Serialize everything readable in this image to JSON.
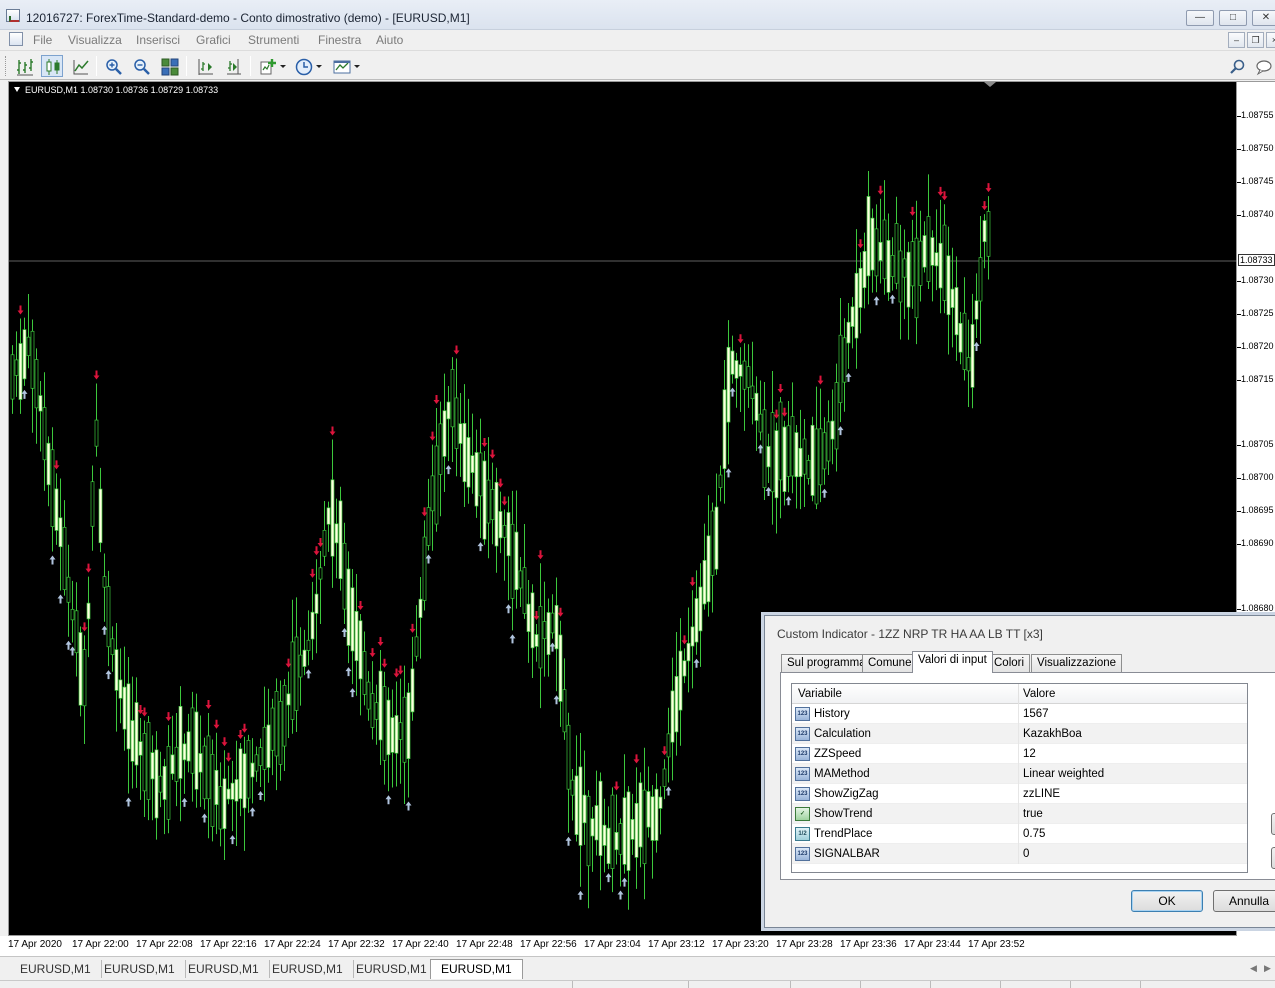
{
  "window": {
    "title": "12016727: ForexTime-Standard-demo - Conto dimostrativo (demo) - [EURUSD,M1]"
  },
  "menu": {
    "items": [
      "File",
      "Visualizza",
      "Inserisci",
      "Grafici",
      "Strumenti",
      "Finestra",
      "Aiuto"
    ]
  },
  "toolbar": {
    "buttons": [
      "bar-chart-icon",
      "candlestick-icon",
      "line-chart-icon",
      "zoom-in-icon",
      "zoom-out-icon",
      "tile-windows-icon",
      "chart-shift-icon",
      "autoscroll-icon",
      "indicators-icon",
      "periods-icon",
      "templates-icon"
    ],
    "right_icons": [
      "search-icon",
      "chat-icon"
    ]
  },
  "chart": {
    "symbol_label": "EURUSD,M1  1.08730 1.08736 1.08729 1.08733",
    "current_price": "1.08733",
    "price_labels": [
      "1.08755",
      "1.08750",
      "1.08745",
      "1.08740",
      "1.08730",
      "1.08725",
      "1.08720",
      "1.08715",
      "1.08705",
      "1.08700",
      "1.08695",
      "1.08690",
      "1.08680"
    ],
    "time_labels": [
      "17 Apr 2020",
      "17 Apr 22:00",
      "17 Apr 22:08",
      "17 Apr 22:16",
      "17 Apr 22:24",
      "17 Apr 22:32",
      "17 Apr 22:40",
      "17 Apr 22:48",
      "17 Apr 22:56",
      "17 Apr 23:04",
      "17 Apr 23:12",
      "17 Apr 23:20",
      "17 Apr 23:28",
      "17 Apr 23:36",
      "17 Apr 23:44",
      "17 Apr 23:52"
    ],
    "colors": {
      "background": "#000000",
      "bull_body": "#ffffe0",
      "wick": "#3cc83c",
      "sell_arrow": "#dc143c",
      "buy_arrow": "#b0c4de",
      "bid_line": "#c0c0c0"
    }
  },
  "tabs": [
    "EURUSD,M1",
    "EURUSD,M1",
    "EURUSD,M1",
    "EURUSD,M1",
    "EURUSD,M1",
    "EURUSD,M1"
  ],
  "dialog": {
    "title": "Custom Indicator - 1ZZ NRP TR HA AA LB TT [x3]",
    "tabs": [
      "Sul programma",
      "Comune",
      "Valori di input",
      "Colori",
      "Visualizzazione"
    ],
    "active_tab": "Valori di input",
    "columns": {
      "name": "Variabile",
      "value": "Valore"
    },
    "rows": [
      {
        "type_icon": "123",
        "name": "History",
        "value": "1567"
      },
      {
        "type_icon": "123",
        "name": "Calculation",
        "value": "KazakhBoa"
      },
      {
        "type_icon": "123",
        "name": "ZZSpeed",
        "value": "12"
      },
      {
        "type_icon": "123",
        "name": "MAMethod",
        "value": "Linear weighted"
      },
      {
        "type_icon": "123",
        "name": "ShowZigZag",
        "value": "zzLINE"
      },
      {
        "type_icon": "bool",
        "name": "ShowTrend",
        "value": "true"
      },
      {
        "type_icon": "1/2",
        "name": "TrendPlace",
        "value": "0.75"
      },
      {
        "type_icon": "123",
        "name": "SIGNALBAR",
        "value": "0"
      }
    ],
    "ok_label": "OK",
    "cancel_label": "Annulla"
  }
}
